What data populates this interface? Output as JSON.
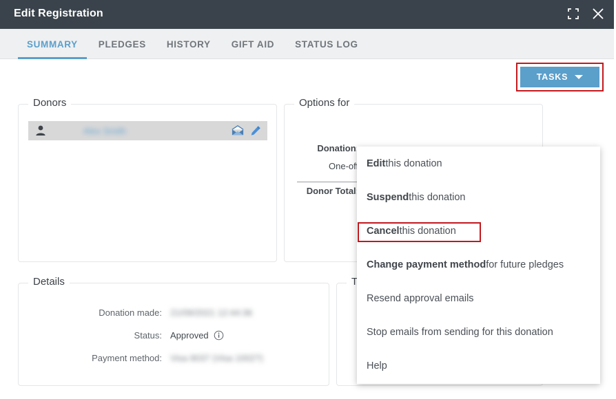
{
  "window": {
    "title": "Edit Registration",
    "controls": [
      {
        "name": "fullscreen-icon",
        "label": "Fullscreen"
      },
      {
        "name": "close-icon",
        "label": "Close"
      }
    ]
  },
  "tabs": [
    {
      "label": "SUMMARY",
      "active": true
    },
    {
      "label": "PLEDGES",
      "active": false
    },
    {
      "label": "HISTORY",
      "active": false
    },
    {
      "label": "GIFT AID",
      "active": false
    },
    {
      "label": "STATUS LOG",
      "active": false
    }
  ],
  "toolbar": {
    "tasks_label": "TASKS",
    "tasks_highlight_color": "#c2181d",
    "tasks_button_color": "#5b9fcb"
  },
  "panels": {
    "donors": {
      "legend": "Donors",
      "rows": [
        {
          "person_icon": "person-icon",
          "name": "Alex Smith",
          "redacted": true,
          "actions": [
            "envelope-icon",
            "edit-pencil-icon"
          ]
        }
      ]
    },
    "options": {
      "legend": "Options for",
      "rows": [
        {
          "label": "Donation:",
          "value": ""
        },
        {
          "label": "",
          "value": "One-off"
        },
        {
          "label": "Donor Total:",
          "value": ""
        }
      ]
    },
    "details": {
      "legend": "Details",
      "rows": [
        {
          "label": "Donation made:",
          "value": "21/09/2021 12:44:36",
          "redacted": true
        },
        {
          "label": "Status:",
          "value": "Approved",
          "redacted": false,
          "info_icon": "info-icon"
        },
        {
          "label": "Payment method:",
          "value": "Visa 9037 (Visa 1002?)",
          "redacted": true
        }
      ]
    },
    "totals": {
      "legend": "To"
    }
  },
  "menu": {
    "items": [
      {
        "bold": "Edit",
        "rest": " this donation",
        "highlighted": false
      },
      {
        "bold": "Suspend",
        "rest": " this donation",
        "highlighted": false
      },
      {
        "bold": "Cancel",
        "rest": " this donation",
        "highlighted": true
      },
      {
        "bold": "Change payment method",
        "rest": " for future pledges",
        "highlighted": false
      },
      {
        "bold": "",
        "rest": "Resend approval emails",
        "highlighted": false
      },
      {
        "bold": "",
        "rest": "Stop emails from sending for this donation",
        "highlighted": false
      },
      {
        "bold": "",
        "rest": "Help",
        "highlighted": false
      }
    ],
    "highlight_color": "#c2181d"
  }
}
